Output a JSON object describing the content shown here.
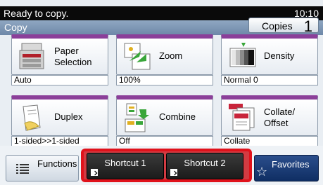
{
  "status": {
    "message": "Ready to copy.",
    "time": "10:10"
  },
  "header": {
    "title": "Copy",
    "copies_label": "Copies",
    "copies_value": "1"
  },
  "tiles": [
    {
      "label_line1": "Paper",
      "label_line2": "Selection",
      "value": "Auto",
      "icon": "paper-tray-icon"
    },
    {
      "label_line1": "Zoom",
      "label_line2": "",
      "value": "100%",
      "icon": "zoom-icon"
    },
    {
      "label_line1": "Density",
      "label_line2": "",
      "value": "Normal 0",
      "icon": "density-icon"
    },
    {
      "label_line1": "Duplex",
      "label_line2": "",
      "value": "1-sided>>1-sided",
      "icon": "duplex-icon"
    },
    {
      "label_line1": "Combine",
      "label_line2": "",
      "value": "Off",
      "icon": "combine-icon"
    },
    {
      "label_line1": "Collate/",
      "label_line2": "Offset",
      "value": "Collate",
      "icon": "collate-icon"
    }
  ],
  "bottom": {
    "functions_label": "Functions",
    "shortcut1_label": "Shortcut 1",
    "shortcut2_label": "Shortcut 2",
    "favorites_label": "Favorites"
  },
  "colors": {
    "tile_accent": "#8b3f99",
    "highlight": "#e0121b",
    "favorites_bg": "#1c3f7a"
  }
}
